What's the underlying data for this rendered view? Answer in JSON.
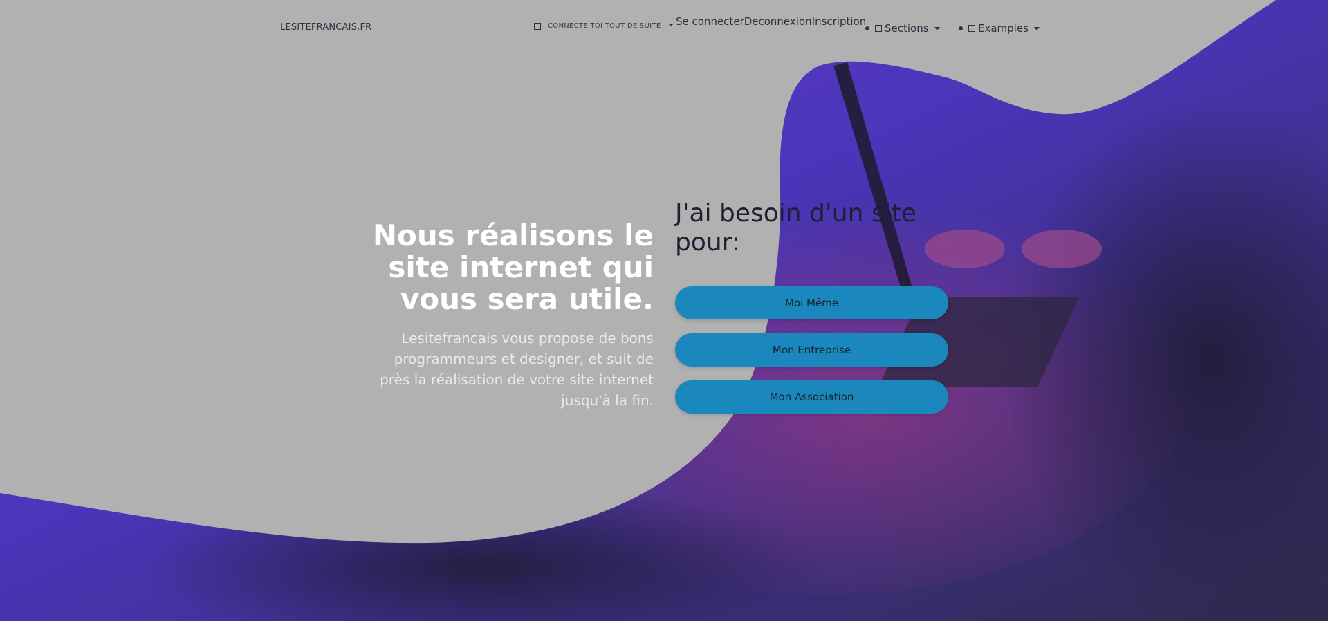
{
  "navbar": {
    "brand": "LESITEFRANCAIS.FR",
    "connect_label": "CONNECTE TOI TOUT DE SUITE",
    "login": "Se connecter",
    "logout": "Deconnexion",
    "signup": "Inscription",
    "sections": "Sections",
    "examples": "Examples"
  },
  "hero": {
    "title": "Nous réalisons le site internet qui vous sera utile.",
    "description": "Lesitefrancais vous propose de bons programmeurs et designer, et suit de près la réalisation de votre site internet jusqu'à la fin.",
    "question": "J'ai besoin d'un site pour:",
    "buttons": [
      "Moi Même",
      "Mon Entreprise",
      "Mon Association"
    ]
  },
  "colors": {
    "background_gray": "#b1b1b1",
    "overlay_purple": "#4a35b8",
    "button_blue": "#1a87bd"
  }
}
